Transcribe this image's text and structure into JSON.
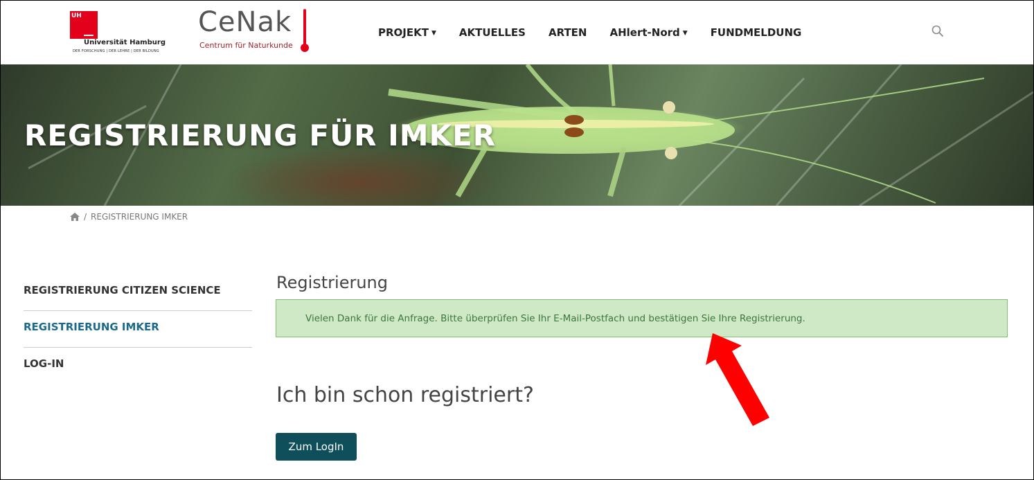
{
  "header": {
    "uh_mark_text": "UH",
    "uh_name": "Universität Hamburg",
    "uh_tagline": "DER FORSCHUNG | DER LEHRE | DER BILDUNG",
    "cenak_title": "CeNak",
    "cenak_subtitle": "Centrum für Naturkunde",
    "nav": [
      {
        "label": "PROJEKT",
        "dropdown": true
      },
      {
        "label": "AKTUELLES",
        "dropdown": false
      },
      {
        "label": "ARTEN",
        "dropdown": false
      },
      {
        "label": "AHlert-Nord",
        "dropdown": true
      },
      {
        "label": "FUNDMELDUNG",
        "dropdown": false
      }
    ],
    "search_icon": "search-icon"
  },
  "banner": {
    "title": "REGISTRIERUNG FÜR IMKER"
  },
  "breadcrumb": {
    "home_icon": "home-icon",
    "separator": "/",
    "current": "REGISTRIERUNG IMKER"
  },
  "sidebar": {
    "items": [
      {
        "label": "REGISTRIERUNG CITIZEN SCIENCE",
        "active": false
      },
      {
        "label": "REGISTRIERUNG IMKER",
        "active": true
      },
      {
        "label": "LOG-IN",
        "active": false
      }
    ]
  },
  "main": {
    "heading": "Registrierung",
    "alert": "Vielen Dank für die Anfrage. Bitte überprüfen Sie Ihr E-Mail-Postfach und bestätigen Sie Ihre Registrierung.",
    "subheading": "Ich bin schon registriert?",
    "login_button": "Zum LogIn"
  },
  "colors": {
    "accent_red": "#e2001a",
    "active_link": "#1b6a8a",
    "alert_bg": "#cfe8c6",
    "alert_text": "#3c763d",
    "button_bg": "#0e4f5b",
    "annotation_arrow": "#ff0000"
  }
}
